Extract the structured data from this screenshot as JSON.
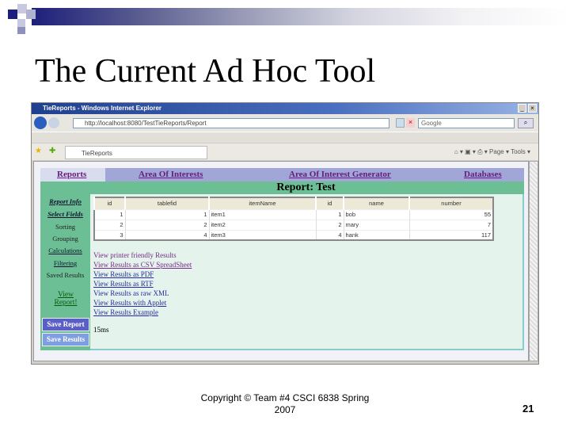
{
  "slide": {
    "title": "The Current Ad Hoc Tool",
    "footer": "Copyright © Team #4 CSCI 6838 Spring 2007",
    "page_number": "21"
  },
  "browser": {
    "window_title": "TieReports - Windows Internet Explorer",
    "url": "http://localhost:8080/TestTieReports/Report",
    "search_placeholder": "Google",
    "tab_title": "TieReports",
    "toolbar": {
      "page": "Page",
      "tools": "Tools"
    }
  },
  "nav": [
    "Reports",
    "Area Of Interests",
    "Area Of Interest Generator",
    "Databases"
  ],
  "report_title": "Report: Test",
  "sidebar": {
    "items": [
      "Report Info",
      "Select Fields",
      "Sorting",
      "Grouping",
      "Calculations",
      "Filtering",
      "Saved Results"
    ],
    "view_report": "View Report!",
    "save_report": "Save Report",
    "save_results": "Save Results"
  },
  "table": {
    "headers": [
      "id",
      "tablefid",
      "itemName",
      "id",
      "name",
      "number"
    ],
    "rows": [
      [
        "1",
        "1",
        "item1",
        "1",
        "bob",
        "55"
      ],
      [
        "2",
        "2",
        "item2",
        "2",
        "mary",
        "7"
      ],
      [
        "3",
        "4",
        "item3",
        "4",
        "hank",
        "117"
      ]
    ]
  },
  "links": [
    "View printer friendly Results",
    "View Results as CSV SpreadSheet",
    "View Results as PDF",
    "View Results as RTF",
    "View Results as raw XML",
    "View Results with Applet",
    "View Results Example"
  ],
  "timing": "15ms",
  "colors": {
    "nav": "#a0a7d6",
    "green": "#6cbf94",
    "panel": "#e4f3ec",
    "button": "#5a5fc8"
  }
}
